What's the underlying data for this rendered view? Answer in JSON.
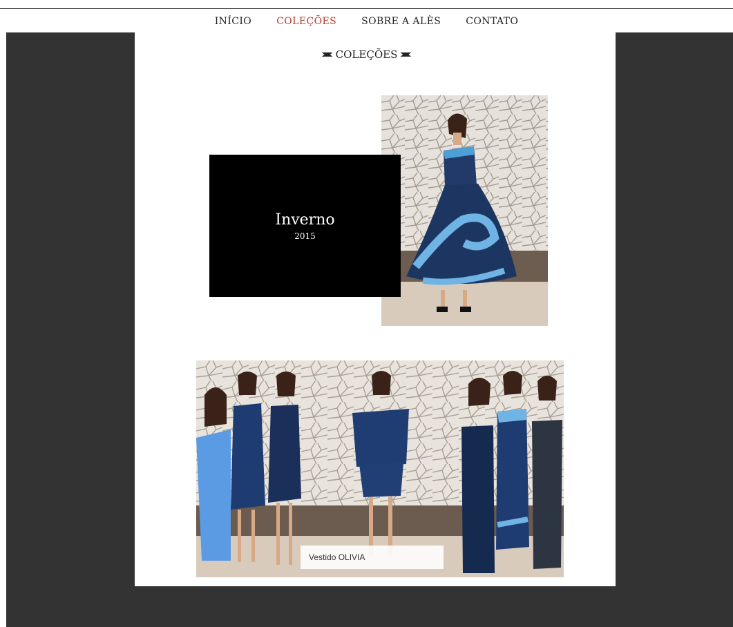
{
  "nav": {
    "items": [
      {
        "label": "Início",
        "active": false
      },
      {
        "label": "Coleções",
        "active": true
      },
      {
        "label": "Sobre a Alès",
        "active": false
      },
      {
        "label": "Contato",
        "active": false
      }
    ],
    "active_color": "#b33a2a"
  },
  "page": {
    "section_title": "Coleções",
    "background_color": "#333333"
  },
  "collection": {
    "name": "Inverno",
    "year": "2015"
  },
  "gallery": {
    "caption": "Vestido OLIVIA",
    "photos": [
      {
        "dress": "light-blue"
      },
      {
        "dress": "navy-pleated"
      },
      {
        "dress": "navy-vneck"
      },
      {
        "dress": "denim-longsleeve-featured"
      },
      {
        "dress": "navy-cutout"
      },
      {
        "dress": "denim-mermaid-blue-trim"
      },
      {
        "dress": "denim-strapless-gown"
      }
    ]
  }
}
